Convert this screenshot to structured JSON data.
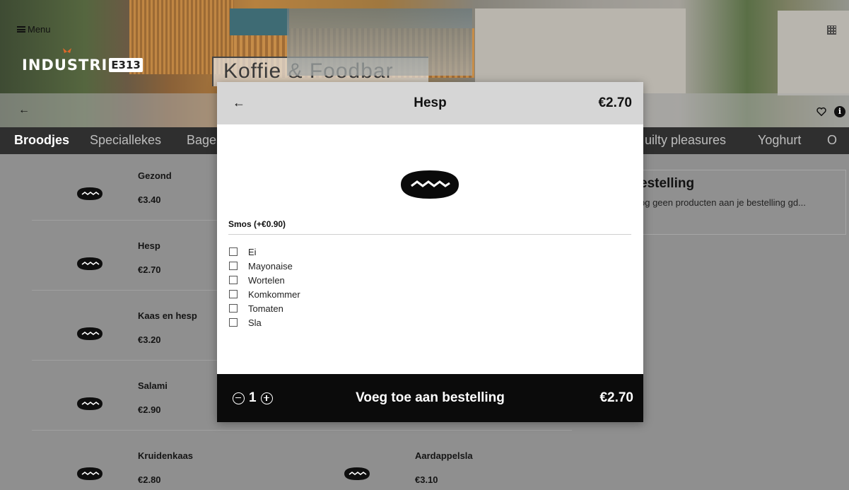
{
  "header": {
    "menu_label": "Menu",
    "logo_text": "INDUSTRI",
    "logo_box": "E313",
    "sign_text": "Koffie & Foodbar"
  },
  "tabs": [
    "Broodjes",
    "Speciallekes",
    "Bage",
    "uilty pleasures",
    "Yoghurt",
    "O"
  ],
  "products": [
    {
      "name": "Gezond",
      "price": "€3.40"
    },
    {
      "name": "Hesp",
      "price": "€2.70"
    },
    {
      "name": "Kaas en hesp",
      "price": "€3.20"
    },
    {
      "name": "Salami",
      "price": "€2.90"
    },
    {
      "name": "Kruidenkaas",
      "price": "€2.80"
    },
    {
      "name": "Aardappelsla",
      "price": "€3.10"
    }
  ],
  "order": {
    "title": "estelling",
    "empty_text": "og geen producten aan je bestelling gd..."
  },
  "modal": {
    "title": "Hesp",
    "price": "€2.70",
    "section_label": "Smos (+€0.90)",
    "options": [
      "Ei",
      "Mayonaise",
      "Wortelen",
      "Komkommer",
      "Tomaten",
      "Sla"
    ],
    "quantity": "1",
    "add_label": "Voeg toe aan bestelling",
    "total": "€2.70"
  },
  "icons": {
    "back": "arrow-left-icon",
    "sandwich": "sandwich-icon",
    "heart": "heart-icon",
    "info": "info-icon",
    "qr": "qr-code-icon",
    "menu": "hamburger-icon"
  }
}
